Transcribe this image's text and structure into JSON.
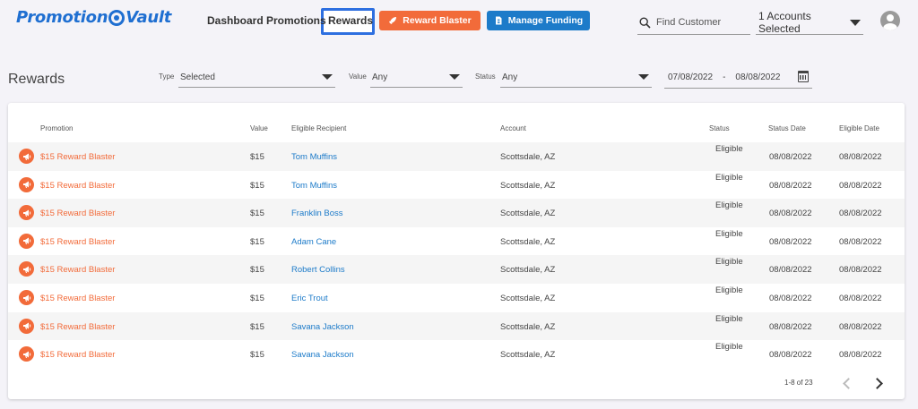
{
  "header": {
    "logo_left": "Promotion",
    "logo_right": "Vault",
    "nav": [
      "Dashboard",
      "Promotions",
      "Rewards"
    ],
    "reward_blaster_label": "Reward Blaster",
    "manage_funding_label": "Manage Funding",
    "search_placeholder": "Find Customer",
    "accounts_selected": "1 Accounts Selected"
  },
  "filters": {
    "page_title": "Rewards",
    "type_label": "Type",
    "type_value": "Selected",
    "value_label": "Value",
    "value_value": "Any",
    "status_label": "Status",
    "status_value": "Any",
    "date_from": "07/08/2022",
    "date_sep": "-",
    "date_to": "08/08/2022"
  },
  "table": {
    "headers": [
      "Promotion",
      "Value",
      "Eligible Recipient",
      "Account",
      "Status",
      "Status Date",
      "Eligible Date"
    ],
    "rows": [
      {
        "promotion": "$15 Reward Blaster",
        "value": "$15",
        "recipient": "Tom Muffins",
        "account": "Scottsdale, AZ",
        "status": "Eligible",
        "status_date": "08/08/2022",
        "eligible_date": "08/08/2022"
      },
      {
        "promotion": "$15 Reward Blaster",
        "value": "$15",
        "recipient": "Tom Muffins",
        "account": "Scottsdale, AZ",
        "status": "Eligible",
        "status_date": "08/08/2022",
        "eligible_date": "08/08/2022"
      },
      {
        "promotion": "$15 Reward Blaster",
        "value": "$15",
        "recipient": "Franklin Boss",
        "account": "Scottsdale, AZ",
        "status": "Eligible",
        "status_date": "08/08/2022",
        "eligible_date": "08/08/2022"
      },
      {
        "promotion": "$15 Reward Blaster",
        "value": "$15",
        "recipient": "Adam Cane",
        "account": "Scottsdale, AZ",
        "status": "Eligible",
        "status_date": "08/08/2022",
        "eligible_date": "08/08/2022"
      },
      {
        "promotion": "$15 Reward Blaster",
        "value": "$15",
        "recipient": "Robert Collins",
        "account": "Scottsdale, AZ",
        "status": "Eligible",
        "status_date": "08/08/2022",
        "eligible_date": "08/08/2022"
      },
      {
        "promotion": "$15 Reward Blaster",
        "value": "$15",
        "recipient": "Eric Trout",
        "account": "Scottsdale, AZ",
        "status": "Eligible",
        "status_date": "08/08/2022",
        "eligible_date": "08/08/2022"
      },
      {
        "promotion": "$15 Reward Blaster",
        "value": "$15",
        "recipient": "Savana Jackson",
        "account": "Scottsdale, AZ",
        "status": "Eligible",
        "status_date": "08/08/2022",
        "eligible_date": "08/08/2022"
      },
      {
        "promotion": "$15 Reward Blaster",
        "value": "$15",
        "recipient": "Savana Jackson",
        "account": "Scottsdale, AZ",
        "status": "Eligible",
        "status_date": "08/08/2022",
        "eligible_date": "08/08/2022"
      }
    ],
    "pagination": "1-8 of 23"
  },
  "colors": {
    "accent_orange": "#f26b3a",
    "accent_blue": "#1d7bc9",
    "highlight_box": "#2d6fe0"
  },
  "icons": {
    "promo_row": "megaphone-icon",
    "reward_blaster": "rocket-icon",
    "manage_funding": "document-icon",
    "search": "search-icon",
    "accounts": "caret-down-icon",
    "avatar": "user-avatar-icon",
    "date": "calendar-icon",
    "prev": "chevron-left-icon",
    "next": "chevron-right-icon"
  }
}
